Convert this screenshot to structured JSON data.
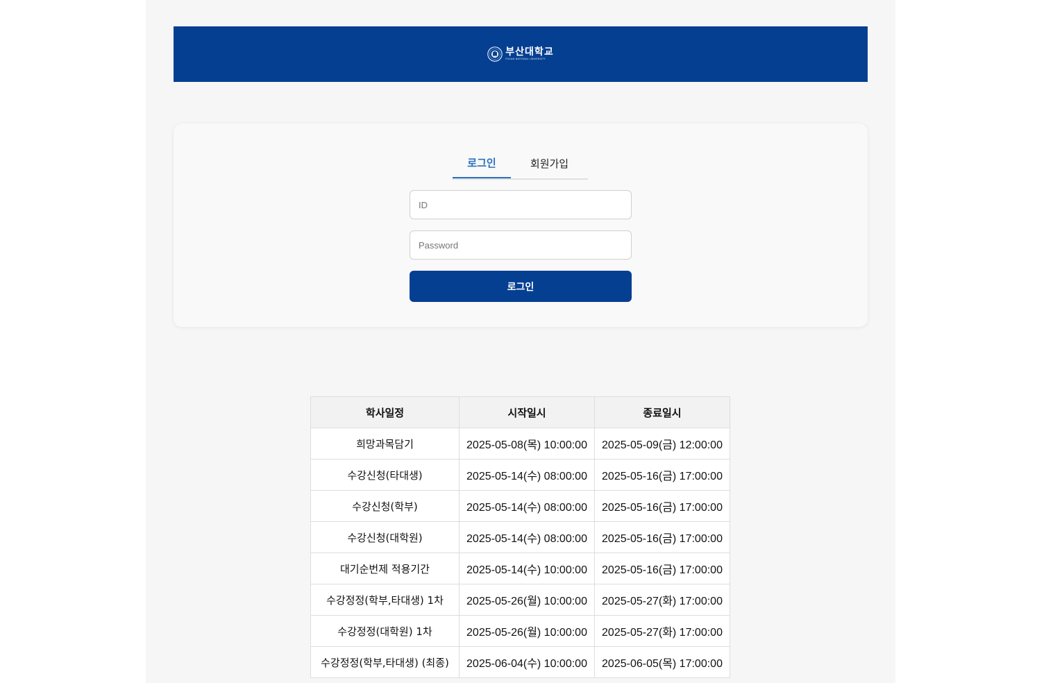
{
  "header": {
    "logo_text_kr": "부산대학교",
    "logo_text_en": "PUSAN NATIONAL UNIVERSITY",
    "logo_icon": "university-seal-icon",
    "background_color": "#043f91"
  },
  "auth": {
    "tabs": [
      {
        "label": "로그인",
        "active": true
      },
      {
        "label": "회원가입",
        "active": false
      }
    ],
    "id_placeholder": "ID",
    "password_placeholder": "Password",
    "submit_label": "로그인",
    "accent_color": "#2a6fbf",
    "button_color": "#043f91"
  },
  "schedule": {
    "headers": [
      "학사일정",
      "시작일시",
      "종료일시"
    ],
    "rows": [
      {
        "name": "희망과목담기",
        "start": "2025-05-08(목) 10:00:00",
        "end": "2025-05-09(금) 12:00:00"
      },
      {
        "name": "수강신청(타대생)",
        "start": "2025-05-14(수) 08:00:00",
        "end": "2025-05-16(금) 17:00:00"
      },
      {
        "name": "수강신청(학부)",
        "start": "2025-05-14(수) 08:00:00",
        "end": "2025-05-16(금) 17:00:00"
      },
      {
        "name": "수강신청(대학원)",
        "start": "2025-05-14(수) 08:00:00",
        "end": "2025-05-16(금) 17:00:00"
      },
      {
        "name": "대기순번제 적용기간",
        "start": "2025-05-14(수) 10:00:00",
        "end": "2025-05-16(금) 17:00:00"
      },
      {
        "name": "수강정정(학부,타대생) 1차",
        "start": "2025-05-26(월) 10:00:00",
        "end": "2025-05-27(화) 17:00:00"
      },
      {
        "name": "수강정정(대학원) 1차",
        "start": "2025-05-26(월) 10:00:00",
        "end": "2025-05-27(화) 17:00:00"
      },
      {
        "name": "수강정정(학부,타대생) (최종)",
        "start": "2025-06-04(수) 10:00:00",
        "end": "2025-06-05(목) 17:00:00"
      }
    ]
  }
}
